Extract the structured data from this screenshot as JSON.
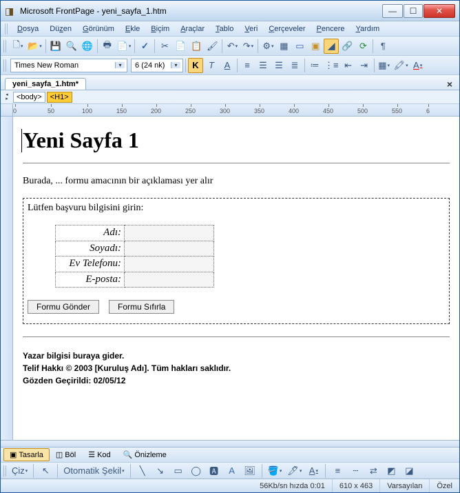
{
  "window": {
    "title": "Microsoft FrontPage - yeni_sayfa_1.htm"
  },
  "menu": {
    "items": [
      "Dosya",
      "Düzen",
      "Görünüm",
      "Ekle",
      "Biçim",
      "Araçlar",
      "Tablo",
      "Veri",
      "Çerçeveler",
      "Pencere",
      "Yardım"
    ]
  },
  "formatbar": {
    "font": "Times New Roman",
    "size": "6 (24 nk)"
  },
  "doctab": {
    "label": "yeni_sayfa_1.htm*"
  },
  "tagselector": {
    "body": "<body>",
    "h1": "<H1>"
  },
  "ruler": {
    "majors": [
      0,
      50,
      100,
      150,
      200,
      250,
      300,
      350,
      400,
      450,
      500,
      550,
      6
    ]
  },
  "page": {
    "heading": "Yeni Sayfa 1",
    "intro": "Burada, ... formu amacının bir açıklaması yer alır",
    "prompt": "Lütfen başvuru bilgisini girin:",
    "fields": [
      {
        "label": "Adı"
      },
      {
        "label": "Soyadı"
      },
      {
        "label": "Ev Telefonu"
      },
      {
        "label": "E-posta"
      }
    ],
    "submit": "Formu Gönder",
    "reset": "Formu Sıfırla",
    "footer1": "Yazar bilgisi buraya gider.",
    "footer2": "Telif Hakkı © 2003 [Kuruluş Adı]. Tüm hakları saklıdır.",
    "footer3": "Gözden Geçirildi: 02/05/12"
  },
  "viewtabs": {
    "design": "Tasarla",
    "split": "Böl",
    "code": "Kod",
    "preview": "Önizleme"
  },
  "drawbar": {
    "ciz": "Çiz",
    "otomatik": "Otomatik Şekil"
  },
  "status": {
    "speed": "56Kb/sn hızda 0:01",
    "dims": "610 x 463",
    "mode": "Varsayılan",
    "custom": "Özel"
  }
}
